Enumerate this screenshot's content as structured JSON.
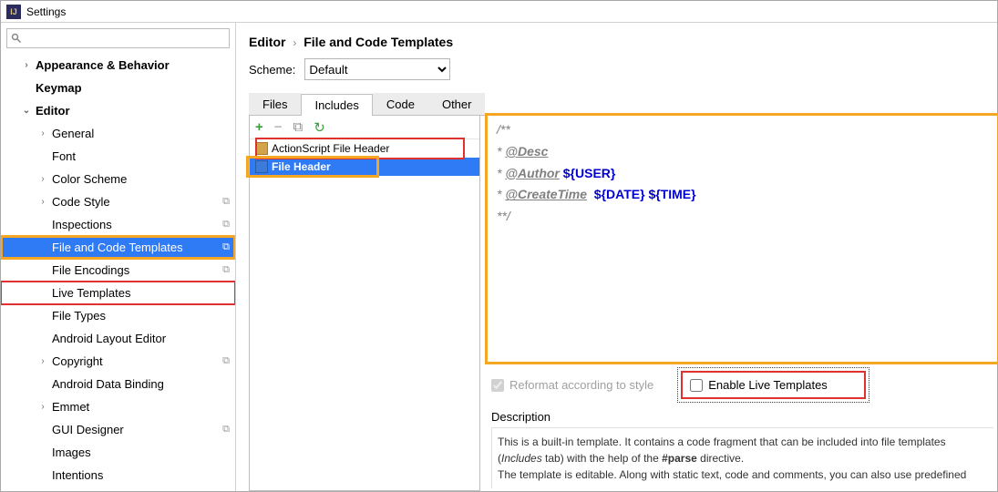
{
  "title": "Settings",
  "breadcrumb": {
    "parent": "Editor",
    "current": "File and Code Templates"
  },
  "scheme": {
    "label": "Scheme:",
    "value": "Default"
  },
  "tabs": [
    "Files",
    "Includes",
    "Code",
    "Other"
  ],
  "active_tab": "Includes",
  "sidebar": {
    "items": [
      {
        "kind": "top",
        "label": "Appearance & Behavior",
        "arrow": "›"
      },
      {
        "kind": "top",
        "label": "Keymap",
        "arrow": ""
      },
      {
        "kind": "top",
        "label": "Editor",
        "arrow": "⌄",
        "expanded": true
      },
      {
        "kind": "sub",
        "label": "General",
        "arrow": "›"
      },
      {
        "kind": "sub",
        "label": "Font",
        "arrow": ""
      },
      {
        "kind": "sub",
        "label": "Color Scheme",
        "arrow": "›"
      },
      {
        "kind": "sub",
        "label": "Code Style",
        "arrow": "›",
        "copy": true
      },
      {
        "kind": "sub",
        "label": "Inspections",
        "arrow": "",
        "copy": true
      },
      {
        "kind": "sub",
        "label": "File and Code Templates",
        "arrow": "",
        "copy": true,
        "selected": true,
        "highlight": "orange"
      },
      {
        "kind": "sub",
        "label": "File Encodings",
        "arrow": "",
        "copy": true
      },
      {
        "kind": "sub",
        "label": "Live Templates",
        "arrow": "",
        "highlight": "red"
      },
      {
        "kind": "sub",
        "label": "File Types",
        "arrow": ""
      },
      {
        "kind": "sub",
        "label": "Android Layout Editor",
        "arrow": ""
      },
      {
        "kind": "sub",
        "label": "Copyright",
        "arrow": "›",
        "copy": true
      },
      {
        "kind": "sub",
        "label": "Android Data Binding",
        "arrow": ""
      },
      {
        "kind": "sub",
        "label": "Emmet",
        "arrow": "›"
      },
      {
        "kind": "sub",
        "label": "GUI Designer",
        "arrow": "",
        "copy": true
      },
      {
        "kind": "sub",
        "label": "Images",
        "arrow": ""
      },
      {
        "kind": "sub",
        "label": "Intentions",
        "arrow": ""
      }
    ]
  },
  "templates": [
    {
      "label": "ActionScript File Header",
      "selected": false
    },
    {
      "label": "File Header",
      "selected": true
    }
  ],
  "code": {
    "l1": "/**",
    "l2_pre": " * ",
    "l2_tag": "@Desc",
    "l3_pre": " * ",
    "l3_tag": "@Author",
    "l3_var": "${USER}",
    "l4_pre": " * ",
    "l4_tag": "@CreateTime",
    "l4_var1": "${DATE}",
    "l4_var2": "${TIME}",
    "l5": " **/"
  },
  "options": {
    "reformat": "Reformat according to style",
    "enable_live": "Enable Live Templates",
    "reformat_checked": true,
    "live_checked": false
  },
  "description": {
    "label": "Description",
    "p1_a": "This is a built-in template. It contains a code fragment that can be included into file templates (",
    "p1_b": " tab) with the help of the ",
    "p1_dir": "#parse",
    "p1_c": " directive.",
    "p2": "The template is editable. Along with static text, code and comments, you can also use predefined"
  }
}
